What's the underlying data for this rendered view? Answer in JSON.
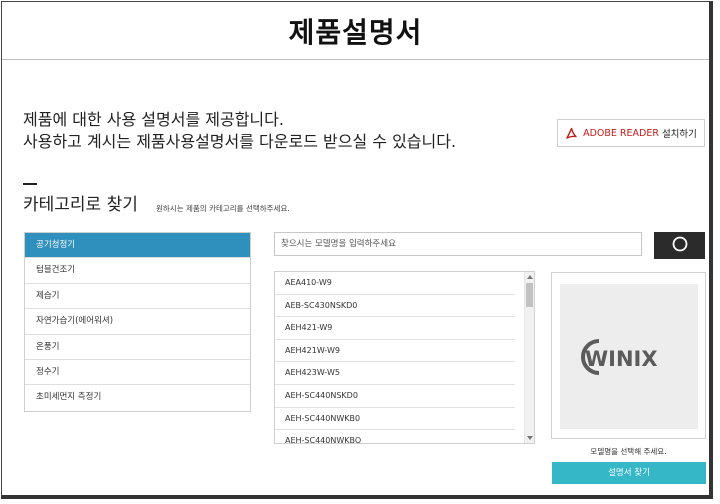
{
  "header": {
    "title": "제품설명서"
  },
  "intro": {
    "line1": "제품에 대한 사용 설명서를 제공합니다.",
    "line2": "사용하고 계시는 제품사용설명서를 다운로드 받으실 수 있습니다."
  },
  "adobe_button": {
    "brand": "ADOBE READER",
    "label": "설치하기"
  },
  "category_section": {
    "title": "카테고리로 찾기",
    "hint": "원하시는 제품의 카테고리를 선택하주세요."
  },
  "categories": [
    {
      "label": "공기청정기",
      "active": true
    },
    {
      "label": "텀블건조기",
      "active": false
    },
    {
      "label": "제습기",
      "active": false
    },
    {
      "label": "자연가습기(에어워셔)",
      "active": false
    },
    {
      "label": "온풍기",
      "active": false
    },
    {
      "label": "정수기",
      "active": false
    },
    {
      "label": "초미세먼지 측정기",
      "active": false
    }
  ],
  "search": {
    "placeholder": "찾으시는 모델명을 입력하주세요"
  },
  "models": [
    "AEA410-W9",
    "AEB-SC430NSKD0",
    "AEH421-W9",
    "AEH421W-W9",
    "AEH423W-W5",
    "AEH-SC440NSKD0",
    "AEH-SC440NWKB0",
    "AEH-SC440NWKBO"
  ],
  "preview": {
    "logo_text": "WINIX",
    "message": "모델명을 선택해 주세요."
  },
  "find_button": {
    "label": "설명서 찾기"
  },
  "colors": {
    "active_category": "#2f8fbd",
    "find_button": "#35b7c7",
    "search_button": "#2b2b2b",
    "adobe_red": "#c21b17"
  }
}
